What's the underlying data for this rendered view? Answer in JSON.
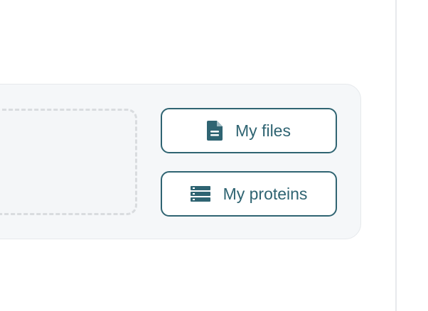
{
  "upload_panel": {
    "my_files_button": {
      "label": "My files",
      "icon": "file-document-icon"
    },
    "my_proteins_button": {
      "label": "My proteins",
      "icon": "database-list-icon"
    }
  },
  "colors": {
    "accent": "#2f6472",
    "panel_bg": "#f5f7f9",
    "dashed_border": "#d9dcdf"
  }
}
